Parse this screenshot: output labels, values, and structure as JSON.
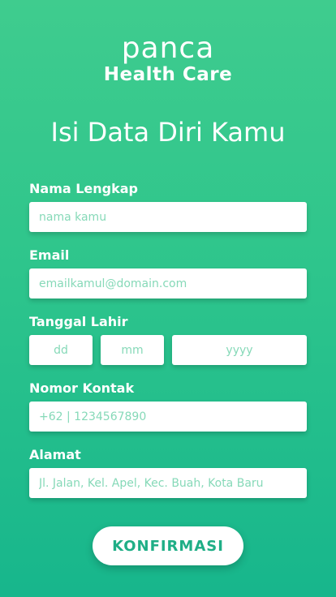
{
  "brand": {
    "logo_text": "panca",
    "subtitle": "Health Care"
  },
  "page_title": "Isi Data Diri Kamu",
  "form": {
    "full_name": {
      "label": "Nama Lengkap",
      "placeholder": "nama kamu",
      "value": ""
    },
    "email": {
      "label": "Email",
      "placeholder": "emailkamul@domain.com",
      "value": ""
    },
    "birth_date": {
      "label": "Tanggal Lahir",
      "day_placeholder": "dd",
      "month_placeholder": "mm",
      "year_placeholder": "yyyy"
    },
    "contact_number": {
      "label": "Nomor Kontak",
      "placeholder": "+62 | 1234567890",
      "value": ""
    },
    "address": {
      "label": "Alamat",
      "placeholder": "Jl. Jalan, Kel. Apel, Kec. Buah, Kota Baru",
      "value": ""
    }
  },
  "confirm_button_label": "KONFIRMASI",
  "colors": {
    "gradient_top": "#3fcc8e",
    "gradient_bottom": "#17b68c",
    "accent_text": "#1fae86",
    "placeholder": "#86d9b8"
  }
}
